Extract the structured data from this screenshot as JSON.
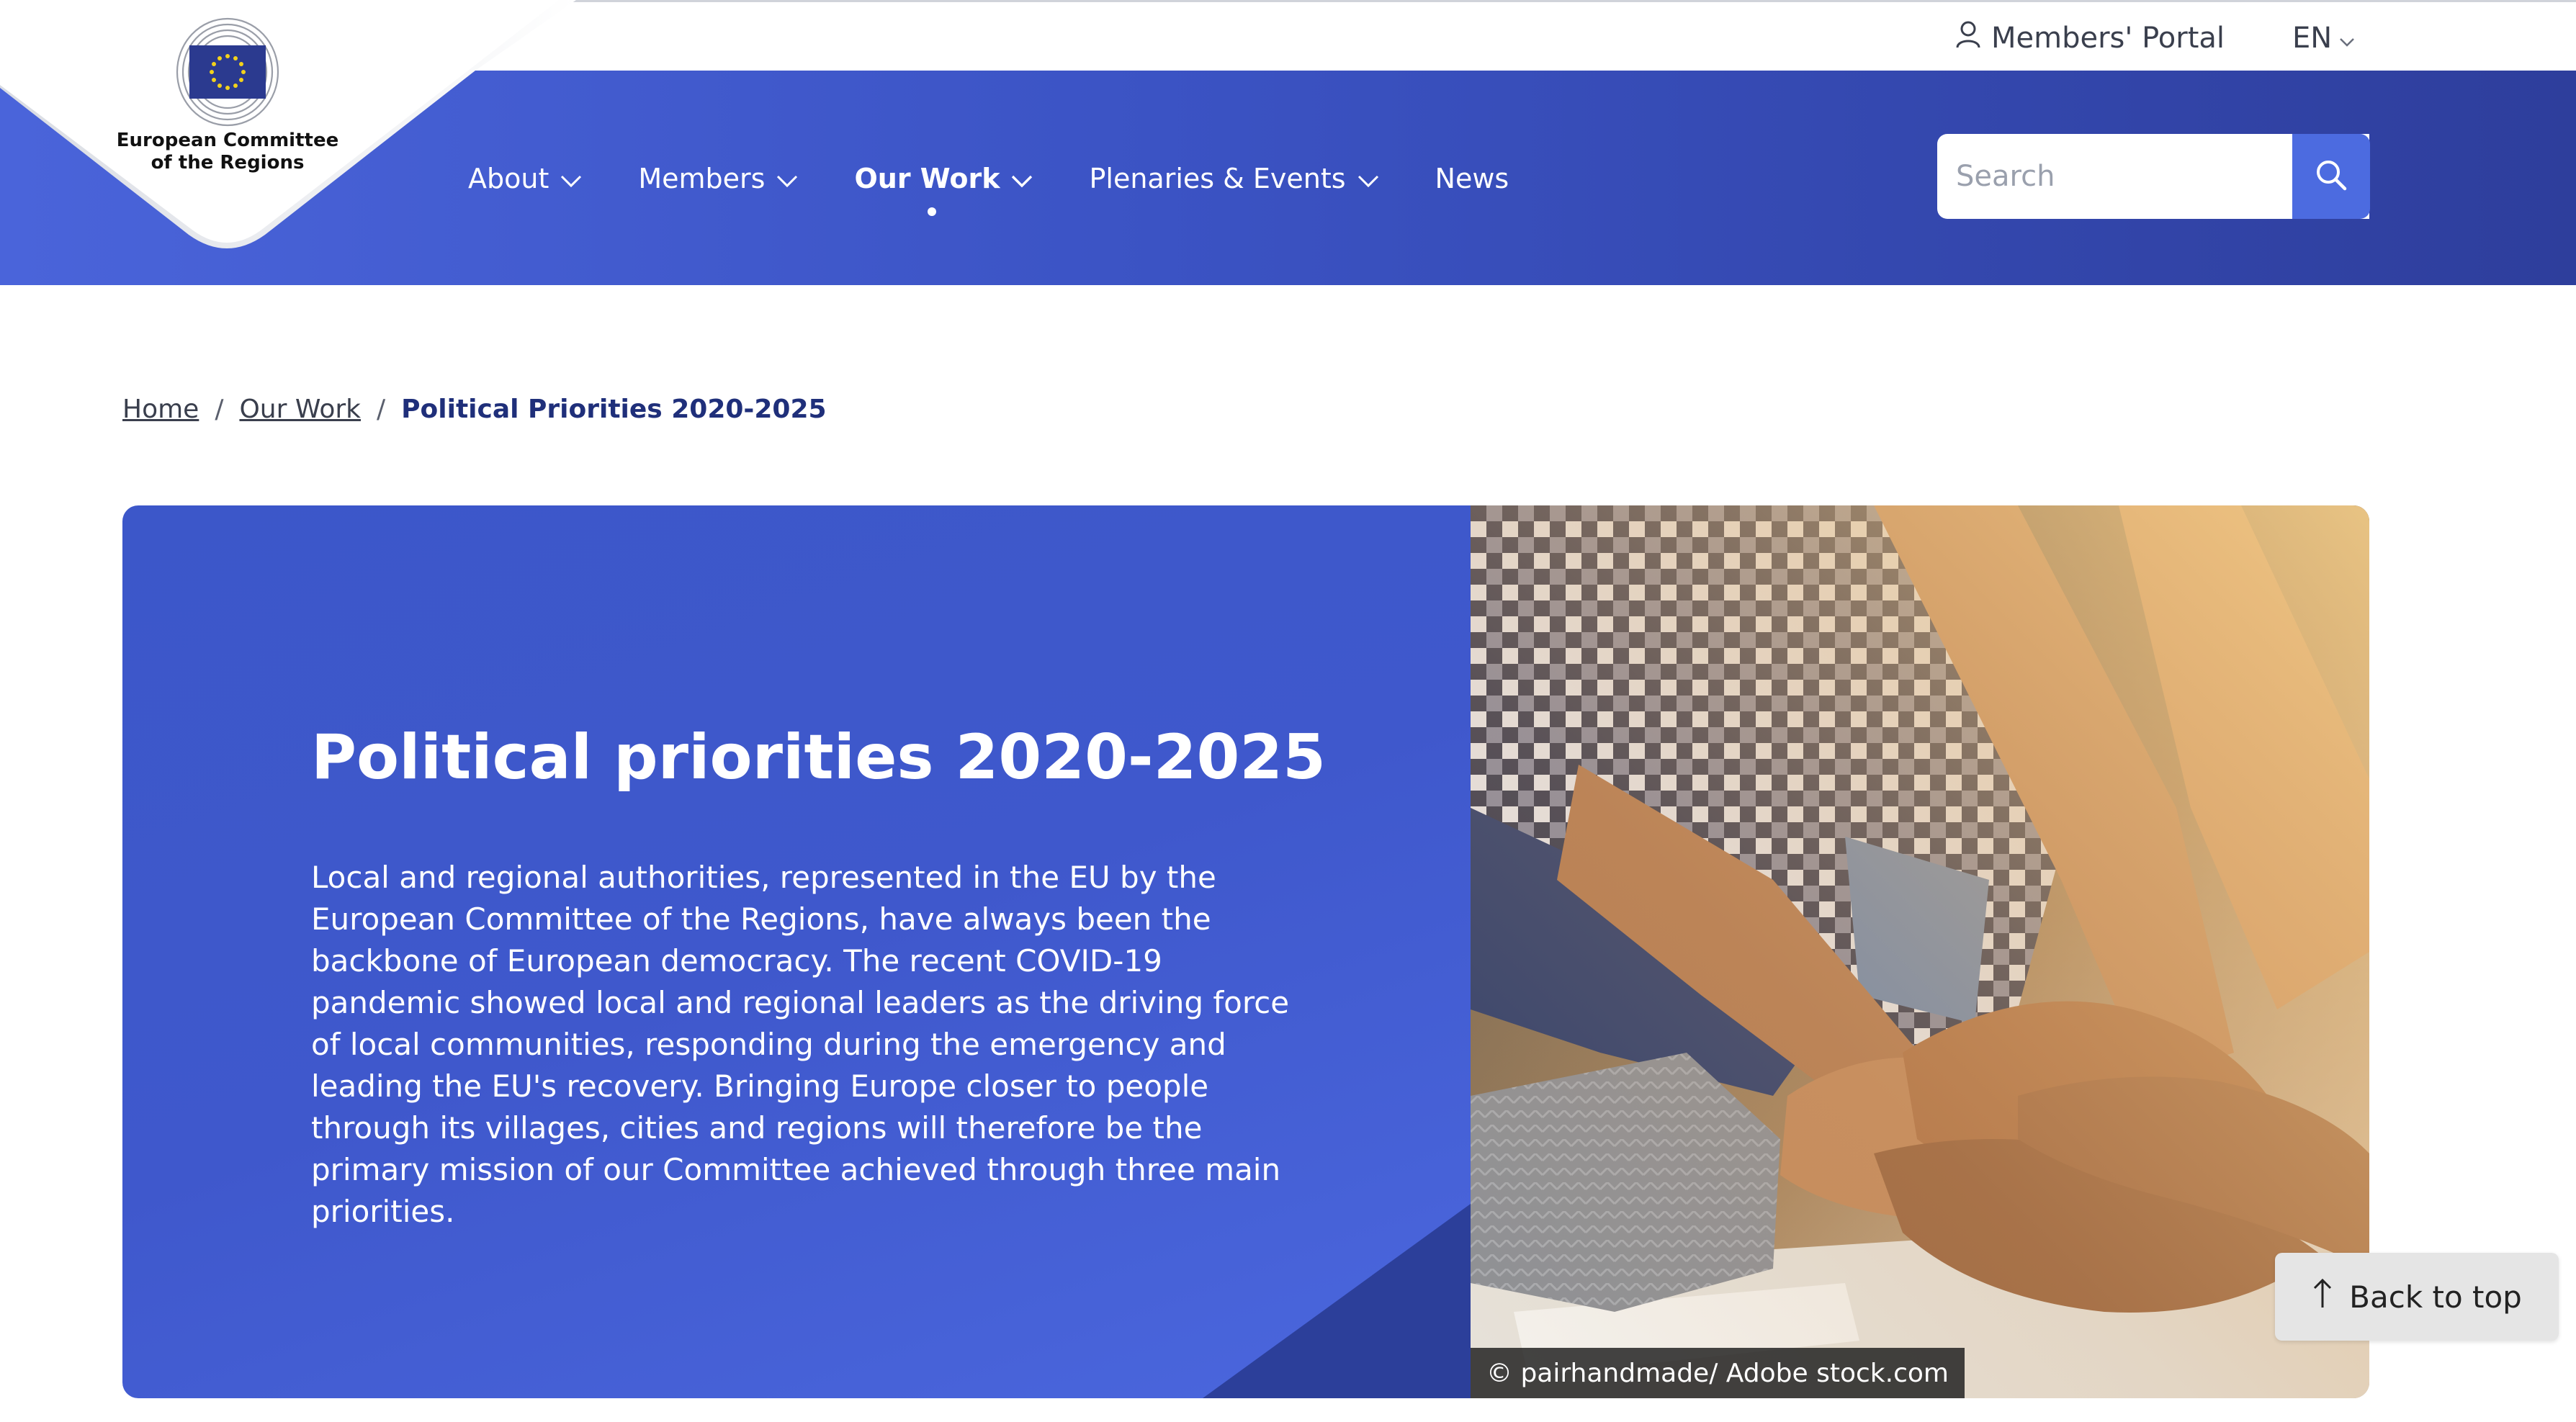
{
  "util": {
    "portal_label": "Members' Portal",
    "lang_label": "EN"
  },
  "logo": {
    "line1": "European Committee",
    "line2": "of the Regions"
  },
  "nav": {
    "items": [
      {
        "label": "About",
        "has_dropdown": true,
        "active": false
      },
      {
        "label": "Members",
        "has_dropdown": true,
        "active": false
      },
      {
        "label": "Our Work",
        "has_dropdown": true,
        "active": true
      },
      {
        "label": "Plenaries & Events",
        "has_dropdown": true,
        "active": false
      },
      {
        "label": "News",
        "has_dropdown": false,
        "active": false
      }
    ]
  },
  "search": {
    "placeholder": "Search",
    "value": ""
  },
  "breadcrumb": {
    "items": [
      "Home",
      "Our Work"
    ],
    "current": "Political Priorities 2020-2025"
  },
  "hero": {
    "title": "Political priorities 2020-2025",
    "body": "Local and regional authorities, represented in the EU by the European Committee of the Regions, have always been the backbone of European democracy. The recent COVID-19 pandemic showed local and regional leaders as the driving force of local communities, responding during the emergency and leading the EU's recovery. Bringing Europe closer to people through its villages, cities and regions will therefore be the primary mission of our Committee achieved through three main priorities.",
    "image_credit": "© pairhandmade/ Adobe stock.com"
  },
  "back_to_top": {
    "label": "Back to top"
  },
  "colors": {
    "brand_blue": "#3b53c4",
    "brand_dark": "#2e3e9c",
    "search_button": "#4c6be0",
    "eu_flag": "#2b3a8f",
    "eu_star": "#f3d21b"
  }
}
